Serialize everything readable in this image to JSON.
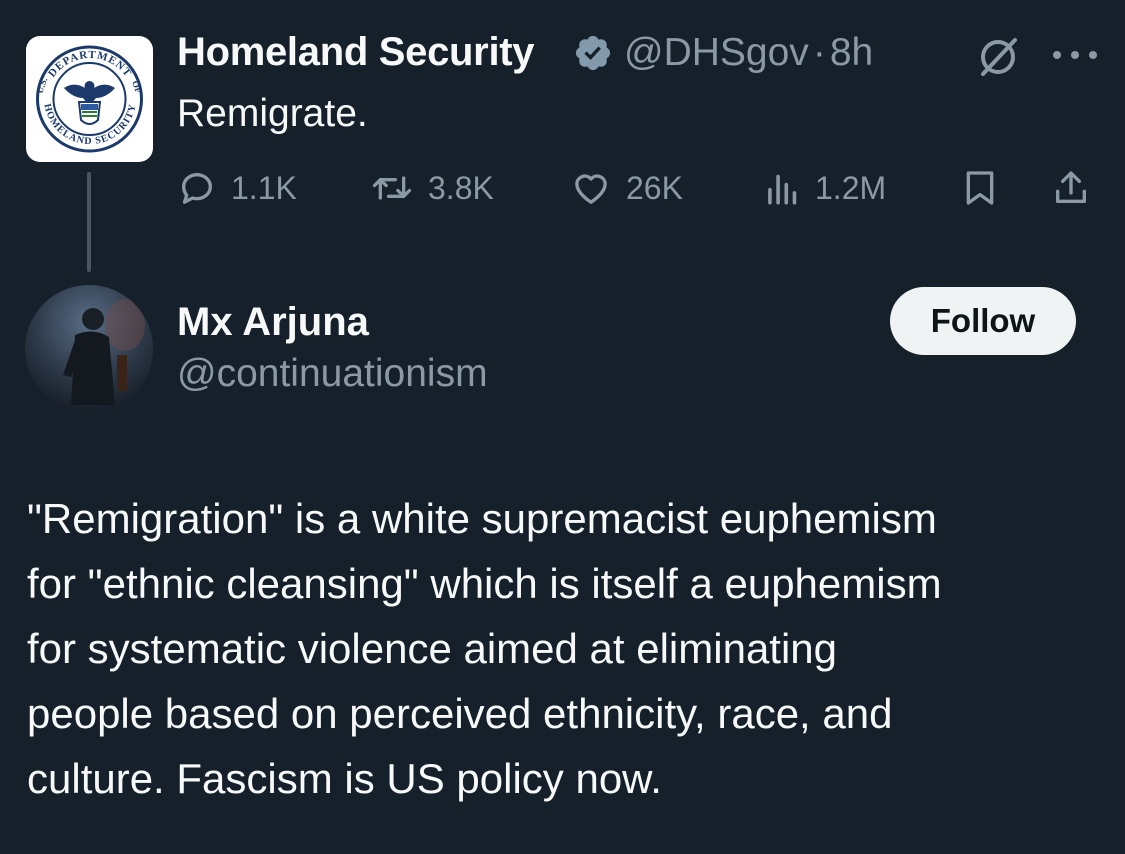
{
  "parent_tweet": {
    "author_name": "Homeland Security",
    "verified": true,
    "handle": "@DHSgov",
    "separator": "·",
    "time": "8h",
    "text": "Remigrate.",
    "avatar_text_top": "DEPARTMENT",
    "avatar_text_left": "U.S.",
    "avatar_text_right": "OF",
    "avatar_text_bottom": "HOMELAND SECURITY",
    "stats": {
      "replies": "1.1K",
      "reposts": "3.8K",
      "likes": "26K",
      "views": "1.2M"
    },
    "icons": [
      "grok-icon",
      "more-icon",
      "reply-icon",
      "repost-icon",
      "like-icon",
      "views-icon",
      "bookmark-icon",
      "share-icon"
    ]
  },
  "user_card": {
    "name": "Mx Arjuna",
    "handle": "@continuationism",
    "follow_label": "Follow"
  },
  "reply_text": {
    "lines": [
      "\"Remigration\" is a white supremacist euphemism",
      "for \"ethnic cleansing\" which is itself a euphemism",
      "for systematic violence aimed at eliminating",
      "people based on perceived ethnicity, race, and",
      "culture. Fascism is US policy now."
    ]
  },
  "colors": {
    "background": "#15202b",
    "text_primary": "#f7f9f9",
    "text_secondary": "#8b98a5",
    "follow_bg": "#eff3f4",
    "thread_line": "#4b5561"
  }
}
